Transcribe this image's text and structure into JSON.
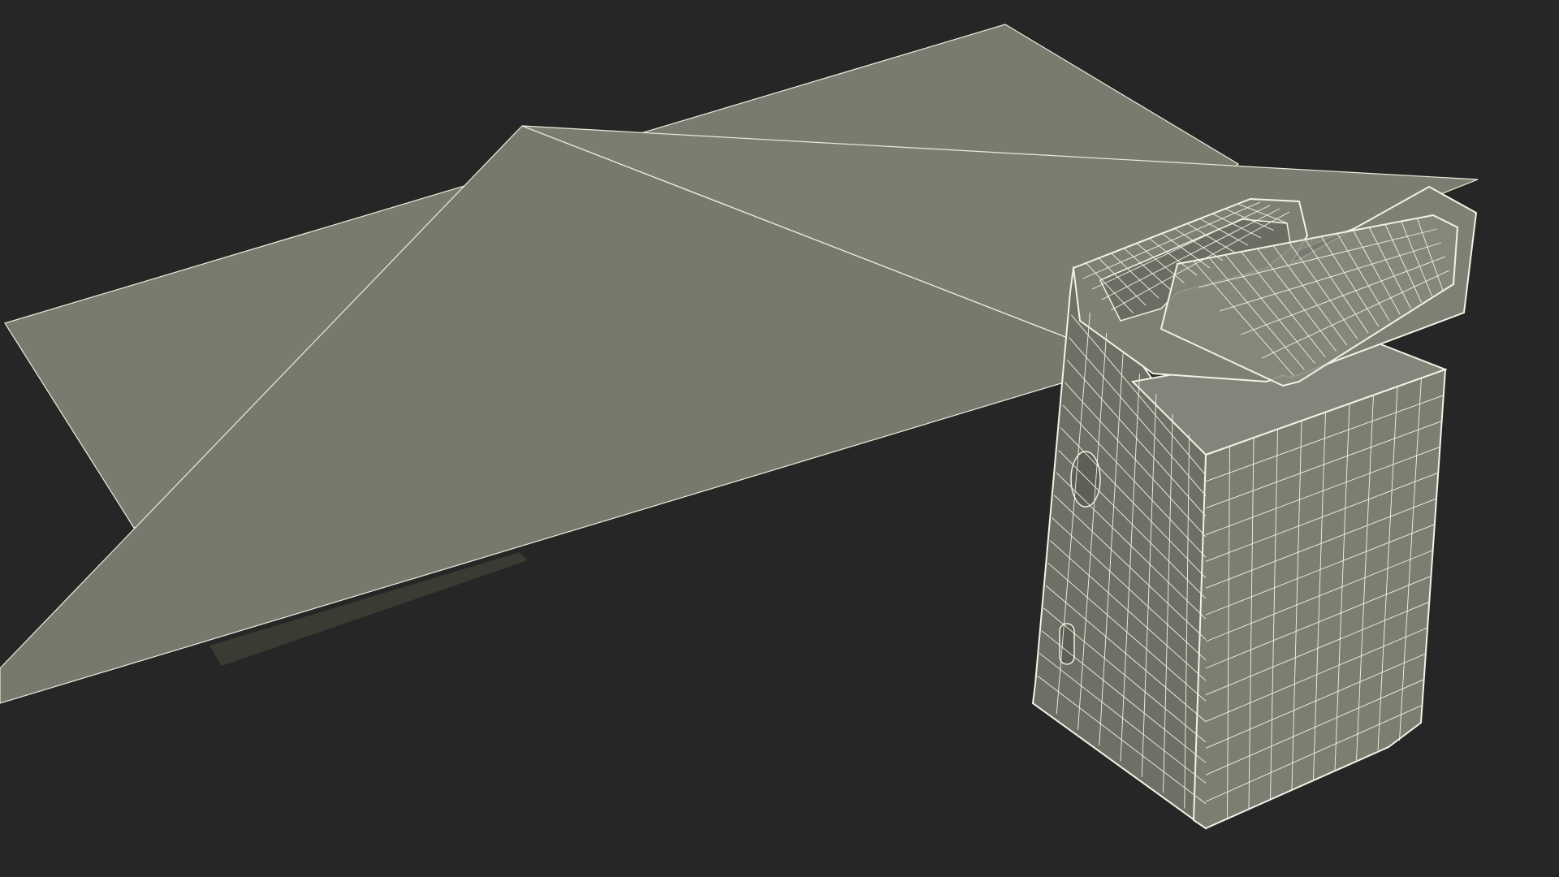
{
  "scene": {
    "background_color": "#262626",
    "objects": [
      "sheet-back",
      "sheet-front",
      "box-wireframe"
    ]
  },
  "colors": {
    "sheet_fill": "#7a7b6f",
    "sheet_shadow": "#505146",
    "wire_line": "#f2f2e6",
    "box_face_front": "#7d7e72",
    "box_face_side": "#6e6f64",
    "box_face_top": "#86877b"
  }
}
